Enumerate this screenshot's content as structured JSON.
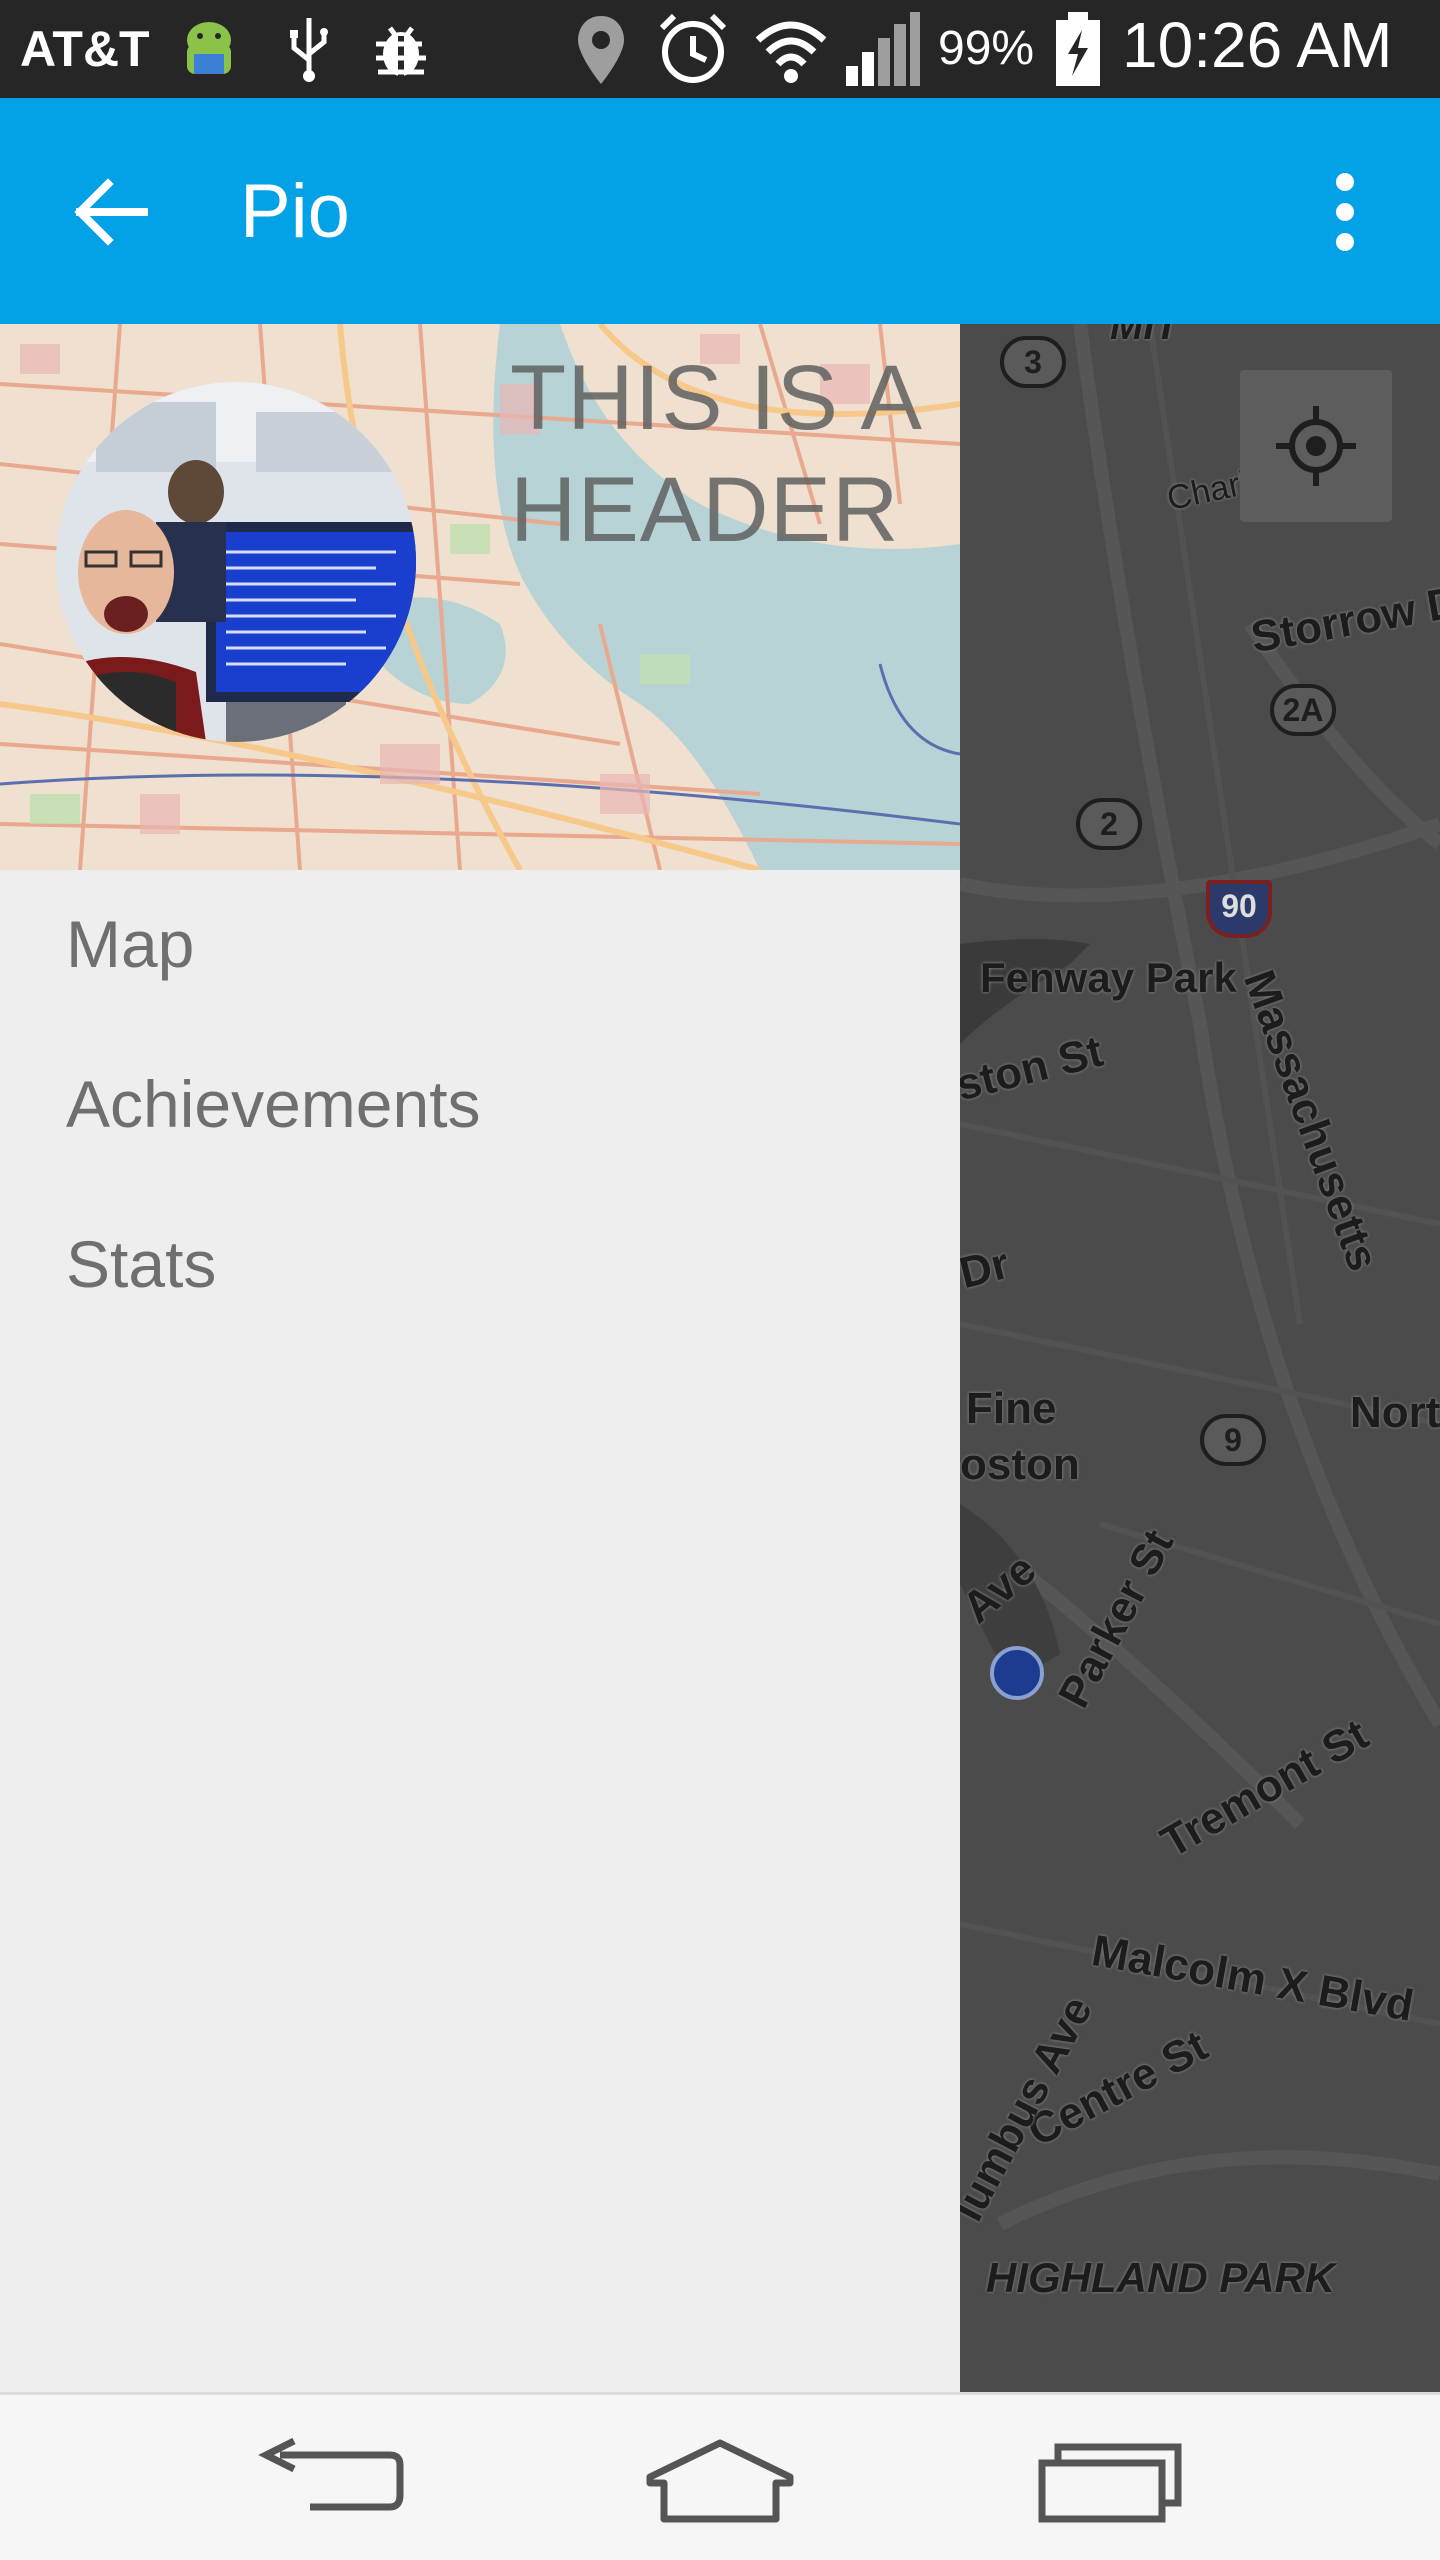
{
  "status_bar": {
    "carrier": "AT&T",
    "battery_percent": "99%",
    "time": "10:26 AM",
    "icons": [
      "android-icon",
      "usb-icon",
      "bug-icon",
      "location-pin-icon",
      "alarm-clock-icon",
      "wifi-icon",
      "signal-icon",
      "battery-charging-icon"
    ]
  },
  "app_bar": {
    "title": "Pio",
    "back_icon": "arrow-back-icon",
    "overflow_icon": "more-vert-icon",
    "color": "#03A1E6"
  },
  "drawer": {
    "header_text": "THIS IS A HEADER",
    "menu": [
      {
        "label": "Map"
      },
      {
        "label": "Achievements"
      },
      {
        "label": "Stats"
      }
    ]
  },
  "map": {
    "labels": {
      "mit": "MIT",
      "charles": "Charles Ri",
      "storrow": "Storrow Dr",
      "fenway": "Fenway Park",
      "boston_st": "ston St",
      "dr": "Dr",
      "fine": "Fine",
      "oston": "oston",
      "north": "Nort",
      "ave": "Ave",
      "parker": "Parker St",
      "tremont": "Tremont St",
      "malcolm": "Malcolm X Blvd",
      "centre": "Centre St",
      "columbus": "lumbus Ave",
      "massachusetts": "Massachusetts",
      "highland": "HIGHLAND PARK"
    },
    "shields": {
      "r3": "3",
      "r2a": "2A",
      "r2": "2",
      "i90": "90",
      "r9": "9"
    }
  },
  "nav_bar": {
    "icons": [
      "back-nav-icon",
      "home-nav-icon",
      "recents-nav-icon"
    ]
  }
}
